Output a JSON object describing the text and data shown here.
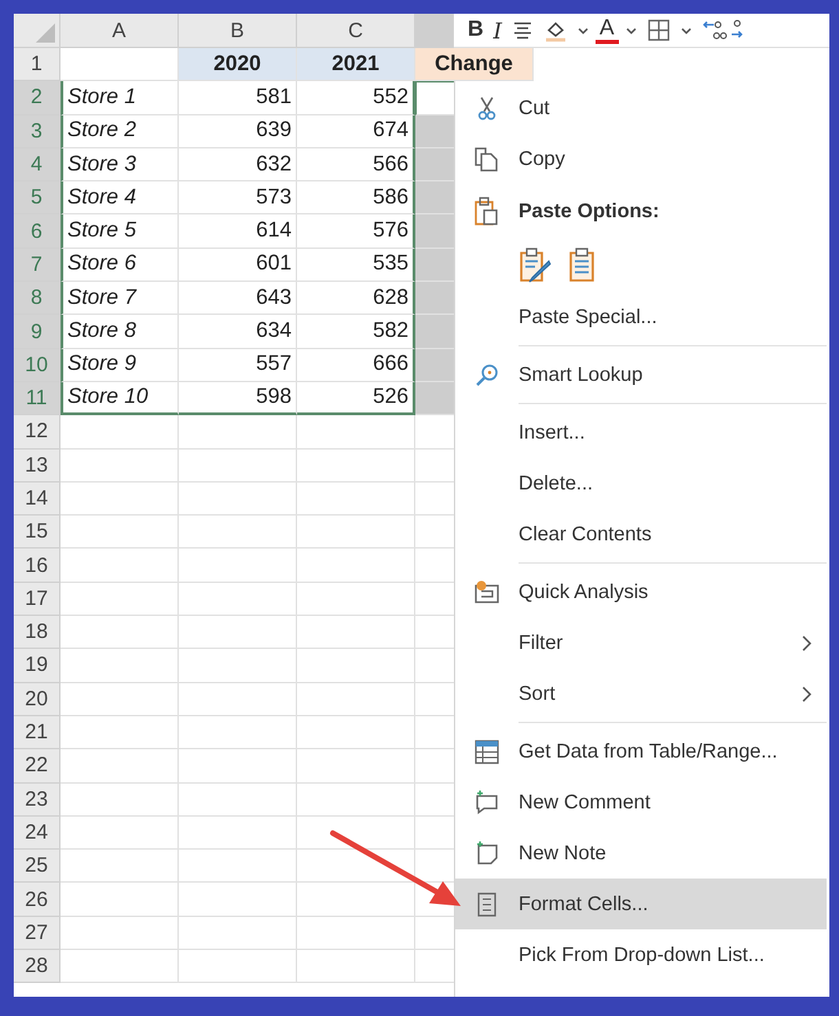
{
  "sheet": {
    "columns": [
      {
        "label": "A"
      },
      {
        "label": "B"
      },
      {
        "label": "C"
      }
    ],
    "rows": [
      {
        "header": "1",
        "selected": false,
        "active": false,
        "cells": [
          "",
          "2020",
          "2021",
          "Change"
        ]
      },
      {
        "header": "2",
        "selected": true,
        "active": true,
        "cells": [
          "Store 1",
          "581",
          "552"
        ]
      },
      {
        "header": "3",
        "selected": true,
        "active": false,
        "cells": [
          "Store 2",
          "639",
          "674"
        ]
      },
      {
        "header": "4",
        "selected": true,
        "active": false,
        "cells": [
          "Store 3",
          "632",
          "566"
        ]
      },
      {
        "header": "5",
        "selected": true,
        "active": false,
        "cells": [
          "Store 4",
          "573",
          "586"
        ]
      },
      {
        "header": "6",
        "selected": true,
        "active": false,
        "cells": [
          "Store 5",
          "614",
          "576"
        ]
      },
      {
        "header": "7",
        "selected": true,
        "active": false,
        "cells": [
          "Store 6",
          "601",
          "535"
        ]
      },
      {
        "header": "8",
        "selected": true,
        "active": false,
        "cells": [
          "Store 7",
          "643",
          "628"
        ]
      },
      {
        "header": "9",
        "selected": true,
        "active": false,
        "cells": [
          "Store 8",
          "634",
          "582"
        ]
      },
      {
        "header": "10",
        "selected": true,
        "active": false,
        "cells": [
          "Store 9",
          "557",
          "666"
        ]
      },
      {
        "header": "11",
        "selected": true,
        "active": false,
        "cells": [
          "Store 10",
          "598",
          "526"
        ]
      },
      {
        "header": "12",
        "selected": false,
        "active": false,
        "cells": []
      },
      {
        "header": "13",
        "selected": false,
        "active": false,
        "cells": []
      },
      {
        "header": "14",
        "selected": false,
        "active": false,
        "cells": []
      },
      {
        "header": "15",
        "selected": false,
        "active": false,
        "cells": []
      },
      {
        "header": "16",
        "selected": false,
        "active": false,
        "cells": []
      },
      {
        "header": "17",
        "selected": false,
        "active": false,
        "cells": []
      },
      {
        "header": "18",
        "selected": false,
        "active": false,
        "cells": []
      },
      {
        "header": "19",
        "selected": false,
        "active": false,
        "cells": []
      },
      {
        "header": "20",
        "selected": false,
        "active": false,
        "cells": []
      },
      {
        "header": "21",
        "selected": false,
        "active": false,
        "cells": []
      },
      {
        "header": "22",
        "selected": false,
        "active": false,
        "cells": []
      },
      {
        "header": "23",
        "selected": false,
        "active": false,
        "cells": []
      },
      {
        "header": "24",
        "selected": false,
        "active": false,
        "cells": []
      },
      {
        "header": "25",
        "selected": false,
        "active": false,
        "cells": []
      },
      {
        "header": "26",
        "selected": false,
        "active": false,
        "cells": []
      },
      {
        "header": "27",
        "selected": false,
        "active": false,
        "cells": []
      },
      {
        "header": "28",
        "selected": false,
        "active": false,
        "cells": []
      }
    ]
  },
  "mini_toolbar": {
    "items": [
      {
        "kind": "text",
        "label": "B"
      },
      {
        "kind": "text",
        "label": "I"
      },
      {
        "kind": "align"
      },
      {
        "kind": "fill"
      },
      {
        "kind": "caret"
      },
      {
        "kind": "fontcolor",
        "label": "A"
      },
      {
        "kind": "caret"
      },
      {
        "kind": "borders"
      },
      {
        "kind": "caret"
      },
      {
        "kind": "decimal"
      }
    ]
  },
  "context_menu": {
    "items": [
      {
        "kind": "item",
        "label": "Cut",
        "submenu": false,
        "selected": false
      },
      {
        "kind": "item",
        "label": "Copy",
        "submenu": false,
        "selected": false
      },
      {
        "kind": "header",
        "label": "Paste Options:"
      },
      {
        "kind": "paste_icons"
      },
      {
        "kind": "item",
        "label": "Paste Special...",
        "submenu": false,
        "selected": false
      },
      {
        "kind": "separator"
      },
      {
        "kind": "item",
        "label": "Smart Lookup",
        "submenu": false,
        "selected": false
      },
      {
        "kind": "separator"
      },
      {
        "kind": "item",
        "label": "Insert...",
        "submenu": false,
        "selected": false
      },
      {
        "kind": "item",
        "label": "Delete...",
        "submenu": false,
        "selected": false
      },
      {
        "kind": "item",
        "label": "Clear Contents",
        "submenu": false,
        "selected": false
      },
      {
        "kind": "separator"
      },
      {
        "kind": "item",
        "label": "Quick Analysis",
        "submenu": false,
        "selected": false
      },
      {
        "kind": "item",
        "label": "Filter",
        "submenu": true,
        "selected": false
      },
      {
        "kind": "item",
        "label": "Sort",
        "submenu": true,
        "selected": false
      },
      {
        "kind": "separator"
      },
      {
        "kind": "item",
        "label": "Get Data from Table/Range...",
        "submenu": false,
        "selected": false
      },
      {
        "kind": "item",
        "label": "New Comment",
        "submenu": false,
        "selected": false
      },
      {
        "kind": "item",
        "label": "New Note",
        "submenu": false,
        "selected": false
      },
      {
        "kind": "item",
        "label": "Format Cells...",
        "submenu": false,
        "selected": true
      },
      {
        "kind": "item",
        "label": "Pick From Drop-down List...",
        "submenu": false,
        "selected": false
      }
    ]
  },
  "annotation": {
    "kind": "arrow"
  }
}
